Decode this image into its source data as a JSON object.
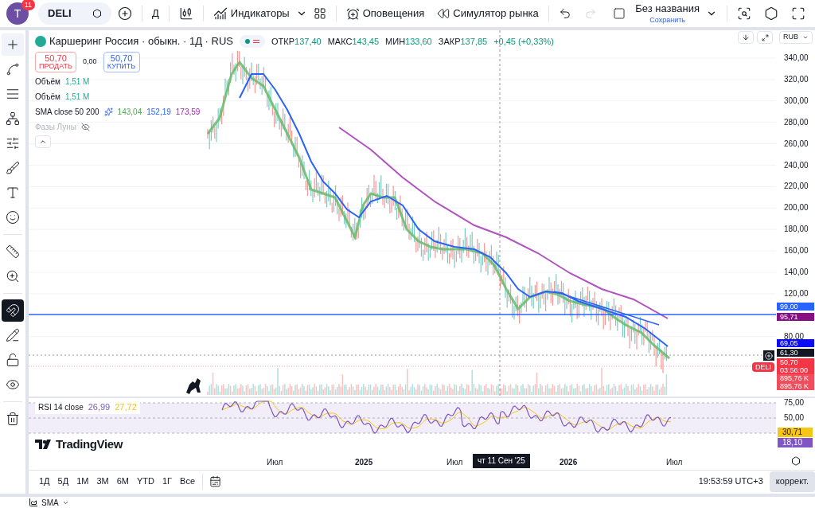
{
  "top_bar": {
    "avatar": "T",
    "notifications": "11",
    "symbol": "DELI",
    "interval": "Д",
    "indicators": "Индикаторы",
    "alerts": "Оповещения",
    "replay": "Симулятор рынка",
    "layout_name": "Без названия",
    "layout_status": "Сохранить"
  },
  "tool_groups": [
    [
      {
        "kind": "crosshair",
        "active": true
      },
      {
        "kind": "trend-line",
        "active": false
      },
      {
        "kind": "fib",
        "active": false
      },
      {
        "kind": "pattern",
        "active": false
      },
      {
        "kind": "projection",
        "active": false
      },
      {
        "kind": "brush",
        "active": false
      },
      {
        "kind": "text",
        "active": false
      },
      {
        "kind": "emoji",
        "active": false
      }
    ],
    [
      {
        "kind": "ruler",
        "active": false
      },
      {
        "kind": "zoom",
        "active": false
      }
    ],
    [
      {
        "kind": "magnet",
        "active": true
      },
      {
        "kind": "lock-drawing",
        "active": false
      },
      {
        "kind": "lock",
        "active": false
      },
      {
        "kind": "eye",
        "active": false
      }
    ],
    [
      {
        "kind": "trash",
        "active": false
      }
    ]
  ],
  "legend": {
    "title": "Каршеринг Россия · обыкн. · 1Д · RUS",
    "ohlc": [
      {
        "label": "ОТКР",
        "value": "137,40"
      },
      {
        "label": "МАКС",
        "value": "143,45"
      },
      {
        "label": "МИН",
        "value": "133,60"
      },
      {
        "label": "ЗАКР",
        "value": "137,85"
      }
    ],
    "change": "+0,45 (+0,33%)",
    "sell": {
      "price": "50,70",
      "label": "ПРОДАТЬ"
    },
    "spread": "0,00",
    "buy": {
      "price": "50,70",
      "label": "КУПИТЬ"
    },
    "indicators": [
      {
        "name": "Объём",
        "hidden": false,
        "values": [
          {
            "text": "1,51 M",
            "color": "#22ab94"
          }
        ]
      },
      {
        "name": "Объём",
        "hidden": false,
        "values": [
          {
            "text": "1,51 M",
            "color": "#22ab94"
          }
        ]
      },
      {
        "name": "SMA close 50 200",
        "hidden": false,
        "values": [
          {
            "text": "143,04",
            "color": "#4caf50"
          },
          {
            "text": "152,19",
            "color": "#2962ff"
          },
          {
            "text": "173,59",
            "color": "#9c27b0"
          }
        ]
      },
      {
        "name": "Фазы Луны",
        "hidden": true
      }
    ]
  },
  "price_axis": {
    "currency": "RUB",
    "ticks": [
      "340,00",
      "320,00",
      "300,00",
      "280,00",
      "260,00",
      "240,00",
      "220,00",
      "200,00",
      "180,00",
      "160,00",
      "140,00",
      "120,00",
      "80,00"
    ],
    "labels": [
      {
        "text": "99,00",
        "color": "#2962ff"
      },
      {
        "text": "95,71",
        "color": "#880e84"
      },
      {
        "text": "69,05",
        "color": "#0c0cf2"
      },
      {
        "text": "61,30",
        "color": "#131722"
      },
      {
        "text": "50,70",
        "color": "#f23645"
      },
      {
        "text": "03:56:00",
        "color": "#f23645"
      },
      {
        "text": "895,76 K",
        "color": "#f04e5c"
      },
      {
        "text": "895,76 K",
        "color": "#f04e5c"
      }
    ],
    "symbol_tag": "DELI"
  },
  "rsi": {
    "title": "RSI 14 close",
    "values": [
      {
        "text": "26,99",
        "color": "#7e57c2"
      },
      {
        "text": "27,72",
        "color": "#f5c518"
      }
    ],
    "ticks": [
      "75,00",
      "50,00"
    ],
    "labels": [
      {
        "text": "30,71",
        "color": "#f5c518"
      },
      {
        "text": "18,10",
        "color": "#7e57c2"
      }
    ]
  },
  "logo": "TradingView",
  "time_axis": {
    "labels": [
      "Июл",
      "2025",
      "Июл",
      "2026",
      "Июл"
    ],
    "crosshair_label": "чт 11 Сен '25"
  },
  "bottom_bar": {
    "ranges": [
      "1Д",
      "5Д",
      "1M",
      "3M",
      "6M",
      "YTD",
      "1Г",
      "Все"
    ],
    "time": "19:53:59 UTC+3",
    "adjust": "коррект."
  },
  "panel": {
    "tab": "SMA"
  }
}
